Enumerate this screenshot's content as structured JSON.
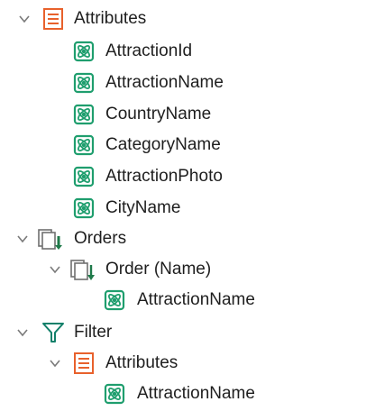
{
  "tree": [
    {
      "label": "Attributes",
      "icon": "attributes-icon",
      "expanded": true
    },
    {
      "label": "AttractionId",
      "icon": "attribute-icon"
    },
    {
      "label": "AttractionName",
      "icon": "attribute-icon"
    },
    {
      "label": "CountryName",
      "icon": "attribute-icon"
    },
    {
      "label": "CategoryName",
      "icon": "attribute-icon"
    },
    {
      "label": "AttractionPhoto",
      "icon": "attribute-icon"
    },
    {
      "label": "CityName",
      "icon": "attribute-icon"
    },
    {
      "label": "Orders",
      "icon": "orders-icon",
      "expanded": true
    },
    {
      "label": "Order (Name)",
      "icon": "order-icon",
      "expanded": true
    },
    {
      "label": "AttractionName",
      "icon": "attribute-icon"
    },
    {
      "label": "Filter",
      "icon": "filter-icon",
      "expanded": true
    },
    {
      "label": "Attributes",
      "icon": "attributes-icon",
      "expanded": true
    },
    {
      "label": "AttractionName",
      "icon": "attribute-icon"
    }
  ],
  "colors": {
    "attribute_green": "#1f9e6e",
    "attributes_orange": "#e8612c",
    "filter_teal": "#12806a",
    "order_green": "#1f7a4a",
    "text": "#1e1e1e",
    "chevron": "#7a7a7a"
  }
}
